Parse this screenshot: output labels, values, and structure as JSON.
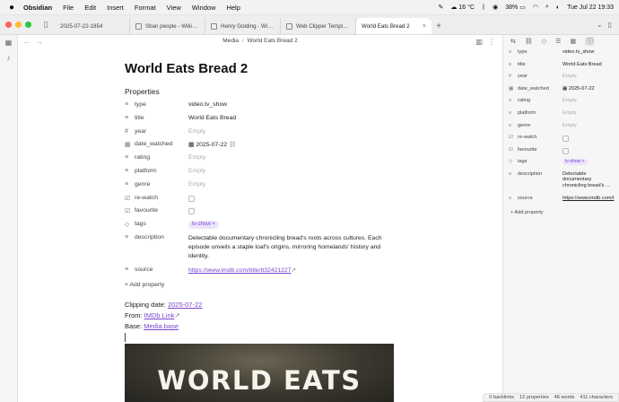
{
  "menubar": {
    "apple": "",
    "app": "Obsidian",
    "items": [
      "File",
      "Edit",
      "Insert",
      "Format",
      "View",
      "Window",
      "Help"
    ],
    "weather": "16 °C",
    "battery": "38%",
    "clock": "Tue Jul 22  19:33"
  },
  "tabs": [
    {
      "label": "2025-07-22-1854"
    },
    {
      "label": "Sban people - Wikipedia"
    },
    {
      "label": "Henry Golding - Wikipedia"
    },
    {
      "label": "Web Clipper Templates"
    },
    {
      "label": "World Eats Bread 2"
    }
  ],
  "breadcrumb": {
    "folder": "Media",
    "note": "World Eats Bread 2"
  },
  "note": {
    "title": "World Eats Bread 2",
    "properties_heading": "Properties",
    "properties": [
      {
        "icon": "≡",
        "key": "type",
        "value": "video.tv_show"
      },
      {
        "icon": "≡",
        "key": "title",
        "value": "World Eats Bread"
      },
      {
        "icon": "#",
        "key": "year",
        "value": "Empty"
      },
      {
        "icon": "▦",
        "key": "date_watched",
        "value": "2025-07-22"
      },
      {
        "icon": "≡",
        "key": "rating",
        "value": "Empty"
      },
      {
        "icon": "≡",
        "key": "platform",
        "value": "Empty"
      },
      {
        "icon": "≡",
        "key": "genre",
        "value": "Empty"
      },
      {
        "icon": "☑",
        "key": "re-watch",
        "value": ""
      },
      {
        "icon": "☑",
        "key": "favourite",
        "value": ""
      },
      {
        "icon": "◇",
        "key": "tags",
        "value": "tv-show"
      },
      {
        "icon": "≡",
        "key": "description",
        "value": "Delectable documentary chronicling bread's roots across cultures. Each episode unveils a staple loaf's origins, mirroring homelands' history and identity."
      },
      {
        "icon": "≡",
        "key": "source",
        "value": "https://www.imdb.com/title/tt32421227"
      }
    ],
    "add_property": "+ Add property",
    "clipping_label": "Clipping date: ",
    "clipping_date": "2025-07-22",
    "from_label": "From: ",
    "from_link": "IMDb Link",
    "base_label": "Base: ",
    "base_link": "Media.base",
    "banner_text": "WORLD EATS"
  },
  "sidebar": {
    "properties": [
      {
        "icon": "≡",
        "key": "type",
        "value": "video.tv_show"
      },
      {
        "icon": "≡",
        "key": "title",
        "value": "World Eats Bread"
      },
      {
        "icon": "#",
        "key": "year",
        "value": "Empty"
      },
      {
        "icon": "▦",
        "key": "date_watched",
        "value": "2025-07-22"
      },
      {
        "icon": "≡",
        "key": "rating",
        "value": "Empty"
      },
      {
        "icon": "≡",
        "key": "platform",
        "value": "Empty"
      },
      {
        "icon": "≡",
        "key": "genre",
        "value": "Empty"
      },
      {
        "icon": "☑",
        "key": "re-watch",
        "value": ""
      },
      {
        "icon": "☑",
        "key": "favourite",
        "value": ""
      },
      {
        "icon": "◇",
        "key": "tags",
        "value": "tv-show"
      },
      {
        "icon": "≡",
        "key": "description",
        "value": "Delectable documentary chronicling bread's ..."
      },
      {
        "icon": "≡",
        "key": "source",
        "value": "https://www.imdb.com/t"
      }
    ],
    "add_property": "+ Add property"
  },
  "status": {
    "backlinks": "0 backlinks",
    "properties": "12 properties",
    "words": "46 words",
    "characters": "411 characters"
  },
  "colors": {
    "accent": "#7a44d0",
    "tag_bg": "#ece4fb"
  }
}
